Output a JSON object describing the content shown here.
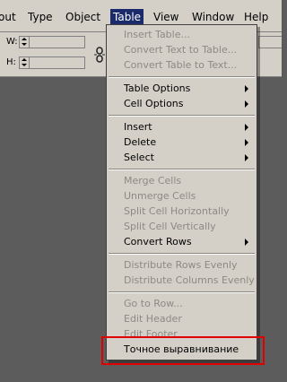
{
  "menubar": {
    "items": [
      "out",
      "Type",
      "Object",
      "Table",
      "View",
      "Window",
      "Help"
    ],
    "active": "Table"
  },
  "controls": {
    "width_label": "W:",
    "height_label": "H:"
  },
  "icons": {
    "chain": "chain-link-icon",
    "submenu": "submenu-arrow-icon"
  },
  "menu": {
    "insert_table": "Insert Table...",
    "convert_text_to_table": "Convert Text to Table...",
    "convert_table_to_text": "Convert Table to Text...",
    "table_options": "Table Options",
    "cell_options": "Cell Options",
    "insert": "Insert",
    "delete": "Delete",
    "select": "Select",
    "merge_cells": "Merge Cells",
    "unmerge_cells": "Unmerge Cells",
    "split_cell_horizontally": "Split Cell Horizontally",
    "split_cell_vertically": "Split Cell Vertically",
    "convert_rows": "Convert Rows",
    "distribute_rows_evenly": "Distribute Rows Evenly",
    "distribute_columns_evenly": "Distribute Columns Evenly",
    "go_to_row": "Go to Row...",
    "edit_header": "Edit Header",
    "edit_footer": "Edit Footer",
    "exact_alignment": "Точное выравнивание"
  },
  "colors": {
    "menu_background": "#d4d0c8",
    "active_menu": "#1b2a6b",
    "highlight_box": "#e00000",
    "disabled_text": "#8c8a85"
  }
}
